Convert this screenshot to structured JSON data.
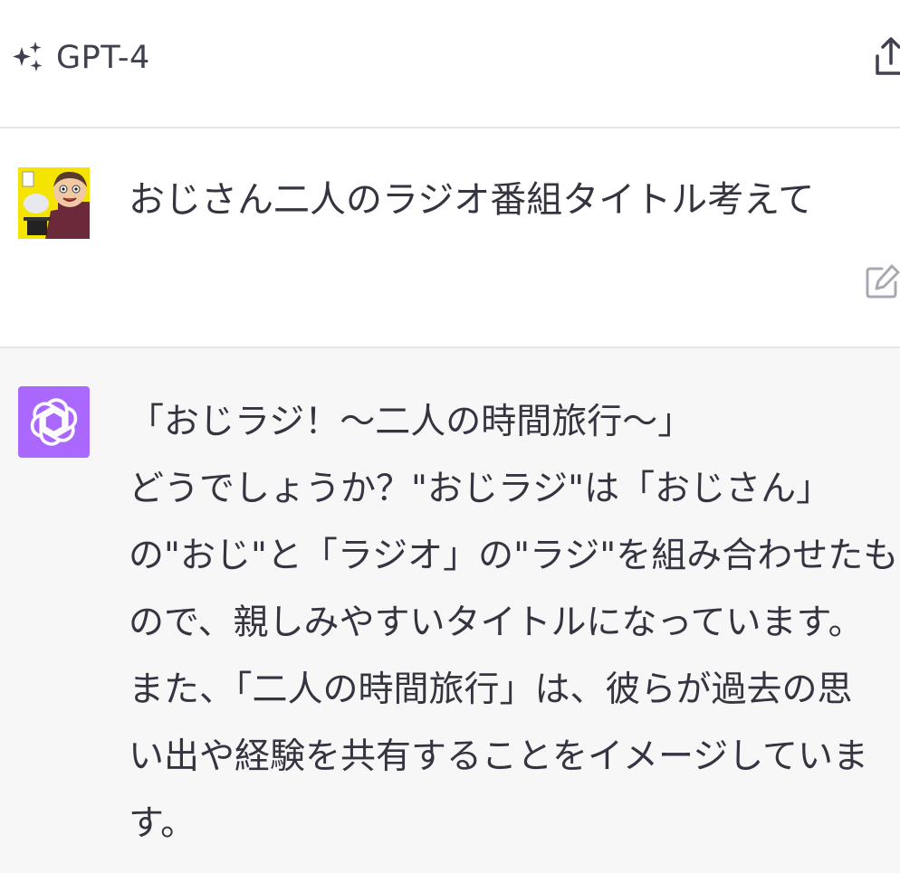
{
  "header": {
    "model_name": "GPT-4",
    "model_icon": "sparkle-icon",
    "share_icon": "share-icon"
  },
  "conversation": {
    "user_message": {
      "avatar": "user-avatar",
      "text": "おじさん二人のラジオ番組タイトル考えて",
      "edit_icon": "edit-icon"
    },
    "assistant_message": {
      "avatar": "openai-logo-icon",
      "avatar_color": "#ab68ff",
      "lines": [
        "「おじラジ！～二人の時間旅行～」",
        "どうでしょうか？\"おじラジ\"は「おじさん」",
        "の\"おじ\"と「ラジオ」の\"ラジ\"を組み合わせたも",
        "ので、親しみやすいタイトルになっています。",
        "また、「二人の時間旅行」は、彼らが過去の思",
        "い出や経験を共有することをイメージしていま",
        "す。"
      ]
    }
  },
  "colors": {
    "header_bg": "#ffffff",
    "assistant_bg": "#f7f7f8",
    "text": "#343541",
    "divider": "#e5e5e5"
  }
}
